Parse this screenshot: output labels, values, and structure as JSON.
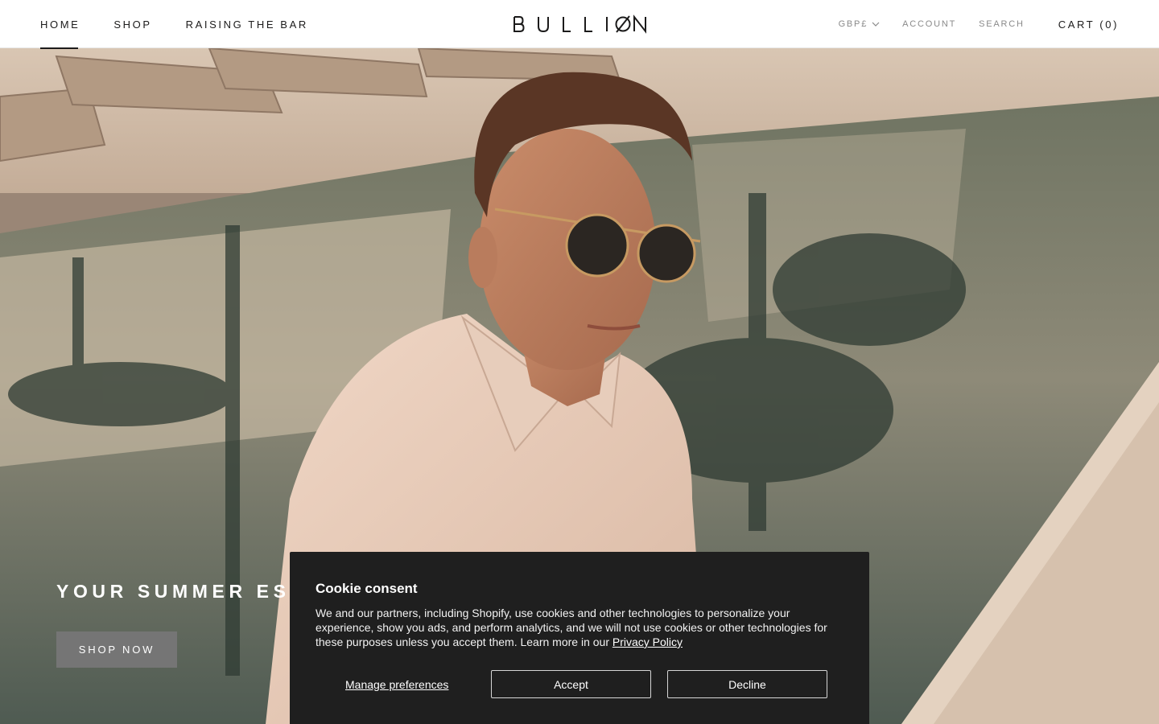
{
  "header": {
    "nav": [
      {
        "label": "HOME",
        "active": true
      },
      {
        "label": "SHOP",
        "active": false
      },
      {
        "label": "RAISING THE BAR",
        "active": false
      }
    ],
    "logo_text": "BULLION",
    "currency": "GBP£",
    "account_label": "ACCOUNT",
    "search_label": "SEARCH",
    "cart_label": "CART (0)"
  },
  "hero": {
    "heading": "YOUR SUMMER ESS",
    "button_label": "SHOP NOW"
  },
  "cookie": {
    "title": "Cookie consent",
    "body": "We and our partners, including Shopify, use cookies and other technologies to personalize your experience, show you ads, and perform analytics, and we will not use cookies or other technologies for these purposes unless you accept them. Learn more in our ",
    "link": "Privacy Policy",
    "manage_label": "Manage preferences",
    "accept_label": "Accept",
    "decline_label": "Decline"
  },
  "colors": {
    "header_bg": "#ffffff",
    "text_dark": "#1c1b1b",
    "text_muted": "#8a8a8a",
    "button_grey": "#757575",
    "cookie_bg": "#1f1f1f"
  },
  "icons": {
    "currency_toggle": "chevron-down-icon"
  }
}
